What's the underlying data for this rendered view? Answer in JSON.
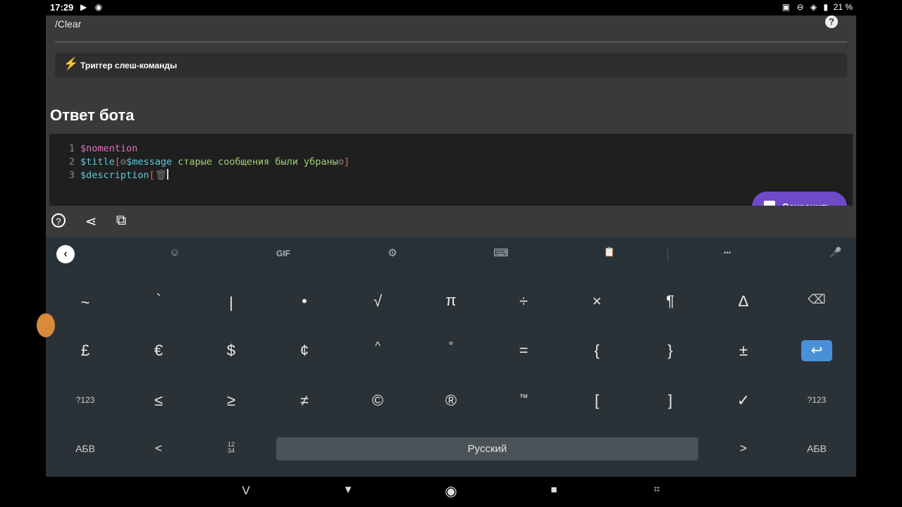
{
  "status_bar": {
    "time": "17:29",
    "battery": "21 %",
    "left_icons": "▶ ◉",
    "right_icons": "▣ ⊖ ◈ ▮"
  },
  "command": {
    "name": "/Clear",
    "help": "?",
    "trigger_label": "Триггер слеш-команды",
    "trigger_icon": "⚡"
  },
  "section": {
    "title": "Ответ бота"
  },
  "code_lines": [
    {
      "n": "1",
      "t1": "$nomention"
    },
    {
      "n": "2",
      "t1": "$title",
      "b1": "[",
      "g1": "⚙",
      "t2": "$message",
      "t3": " старые сообщения были убраны",
      "g2": "⚙",
      "b2": "]"
    },
    {
      "n": "3",
      "t1": "$description",
      "b1": "[",
      "g1": "🗑"
    }
  ],
  "save_button": {
    "label": "Сохранить"
  },
  "tools": {
    "help": "?",
    "share": "⋖",
    "copy": "⧉"
  },
  "keyboard_toolbar": {
    "back": "‹",
    "sticker": "☺",
    "gif": "GIF",
    "settings": "⚙",
    "keyboard": "⌨",
    "clipboard": "📋",
    "more": "•••",
    "mic": "🎤"
  },
  "keys": {
    "row1": [
      "~",
      "`",
      "|",
      "•",
      "√",
      "π",
      "÷",
      "×",
      "¶",
      "∆",
      "⌫"
    ],
    "row2": [
      "£",
      "€",
      "$",
      "¢",
      "^",
      "°",
      "=",
      "{",
      "}",
      "±"
    ],
    "enter": "↩",
    "row3": [
      "?123",
      "≤",
      "≥",
      "≠",
      "©",
      "®",
      "™",
      "[",
      "]",
      "✓",
      "?123"
    ],
    "row4_left": [
      "АБВ",
      "<",
      "12\n34"
    ],
    "space": "Русский",
    "row4_right": [
      ">",
      "АБВ"
    ]
  },
  "nav": {
    "hide": "V",
    "back": "▼",
    "home": "◉",
    "recents": "■",
    "screenshot": "⌗"
  }
}
